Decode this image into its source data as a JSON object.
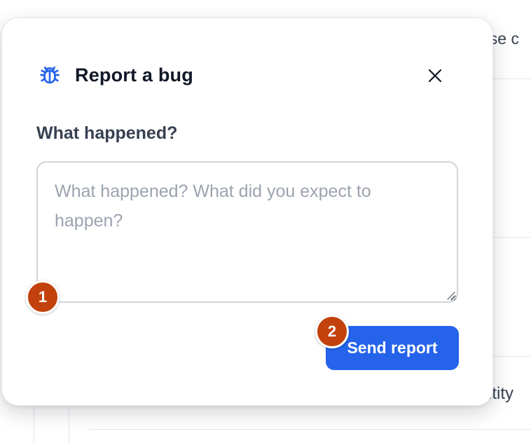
{
  "background": {
    "top_right_fragment": "ase c",
    "bottom_right_fragment": "ntity"
  },
  "modal": {
    "title": "Report a bug",
    "icon": "bug-icon",
    "close_icon": "close-icon",
    "field_label": "What happened?",
    "textarea": {
      "value": "",
      "placeholder": "What happened? What did you expect to happen?"
    },
    "send_button_label": "Send report"
  },
  "badges": {
    "one": "1",
    "two": "2"
  },
  "colors": {
    "accent": "#2563eb",
    "badge": "#c2410c",
    "title": "#111827",
    "label": "#374151",
    "placeholder": "#9ca3af"
  }
}
